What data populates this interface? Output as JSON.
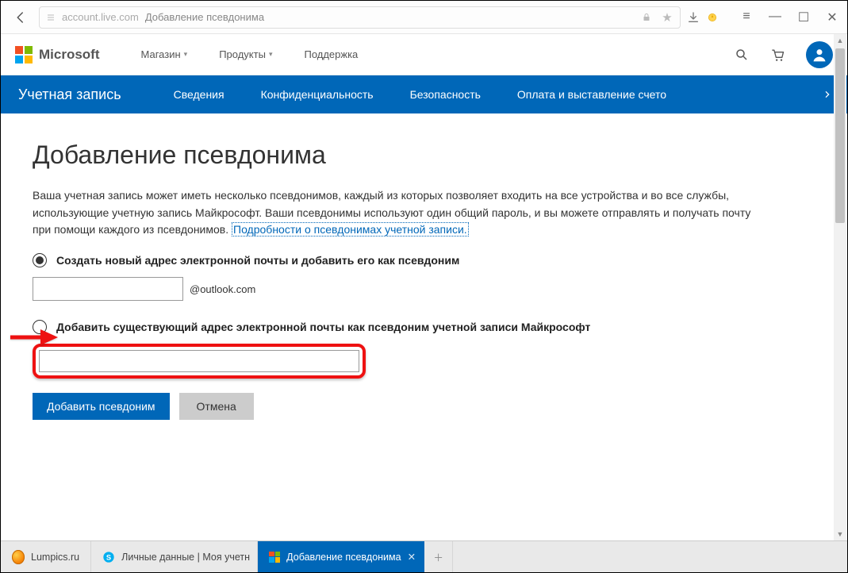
{
  "browser": {
    "url_domain": "account.live.com",
    "url_title": "Добавление псевдонима"
  },
  "header": {
    "logo_text": "Microsoft",
    "nav": {
      "store": "Магазин",
      "products": "Продукты",
      "support": "Поддержка"
    }
  },
  "subnav": {
    "brand": "Учетная запись",
    "items": {
      "info": "Сведения",
      "privacy": "Конфиденциальность",
      "security": "Безопасность",
      "billing": "Оплата и выставление счето"
    }
  },
  "page": {
    "title": "Добавление псевдонима",
    "intro": "Ваша учетная запись может иметь несколько псевдонимов, каждый из которых позволяет входить на все устройства и во все службы, использующие учетную запись Майкрософт. Ваши псевдонимы используют один общий пароль, и вы можете отправлять и получать почту при помощи каждого из псевдонимов. ",
    "learn_more": "Подробности о псевдонимах учетной записи.",
    "option_new": "Создать новый адрес электронной почты и добавить его как псевдоним",
    "email_suffix": "@outlook.com",
    "option_existing": "Добавить существующий адрес электронной почты как псевдоним учетной записи Майкрософт",
    "btn_add": "Добавить псевдоним",
    "btn_cancel": "Отмена"
  },
  "taskbar": {
    "tab1": "Lumpics.ru",
    "tab2": "Личные данные | Моя учетн",
    "tab3": "Добавление псевдонима"
  }
}
